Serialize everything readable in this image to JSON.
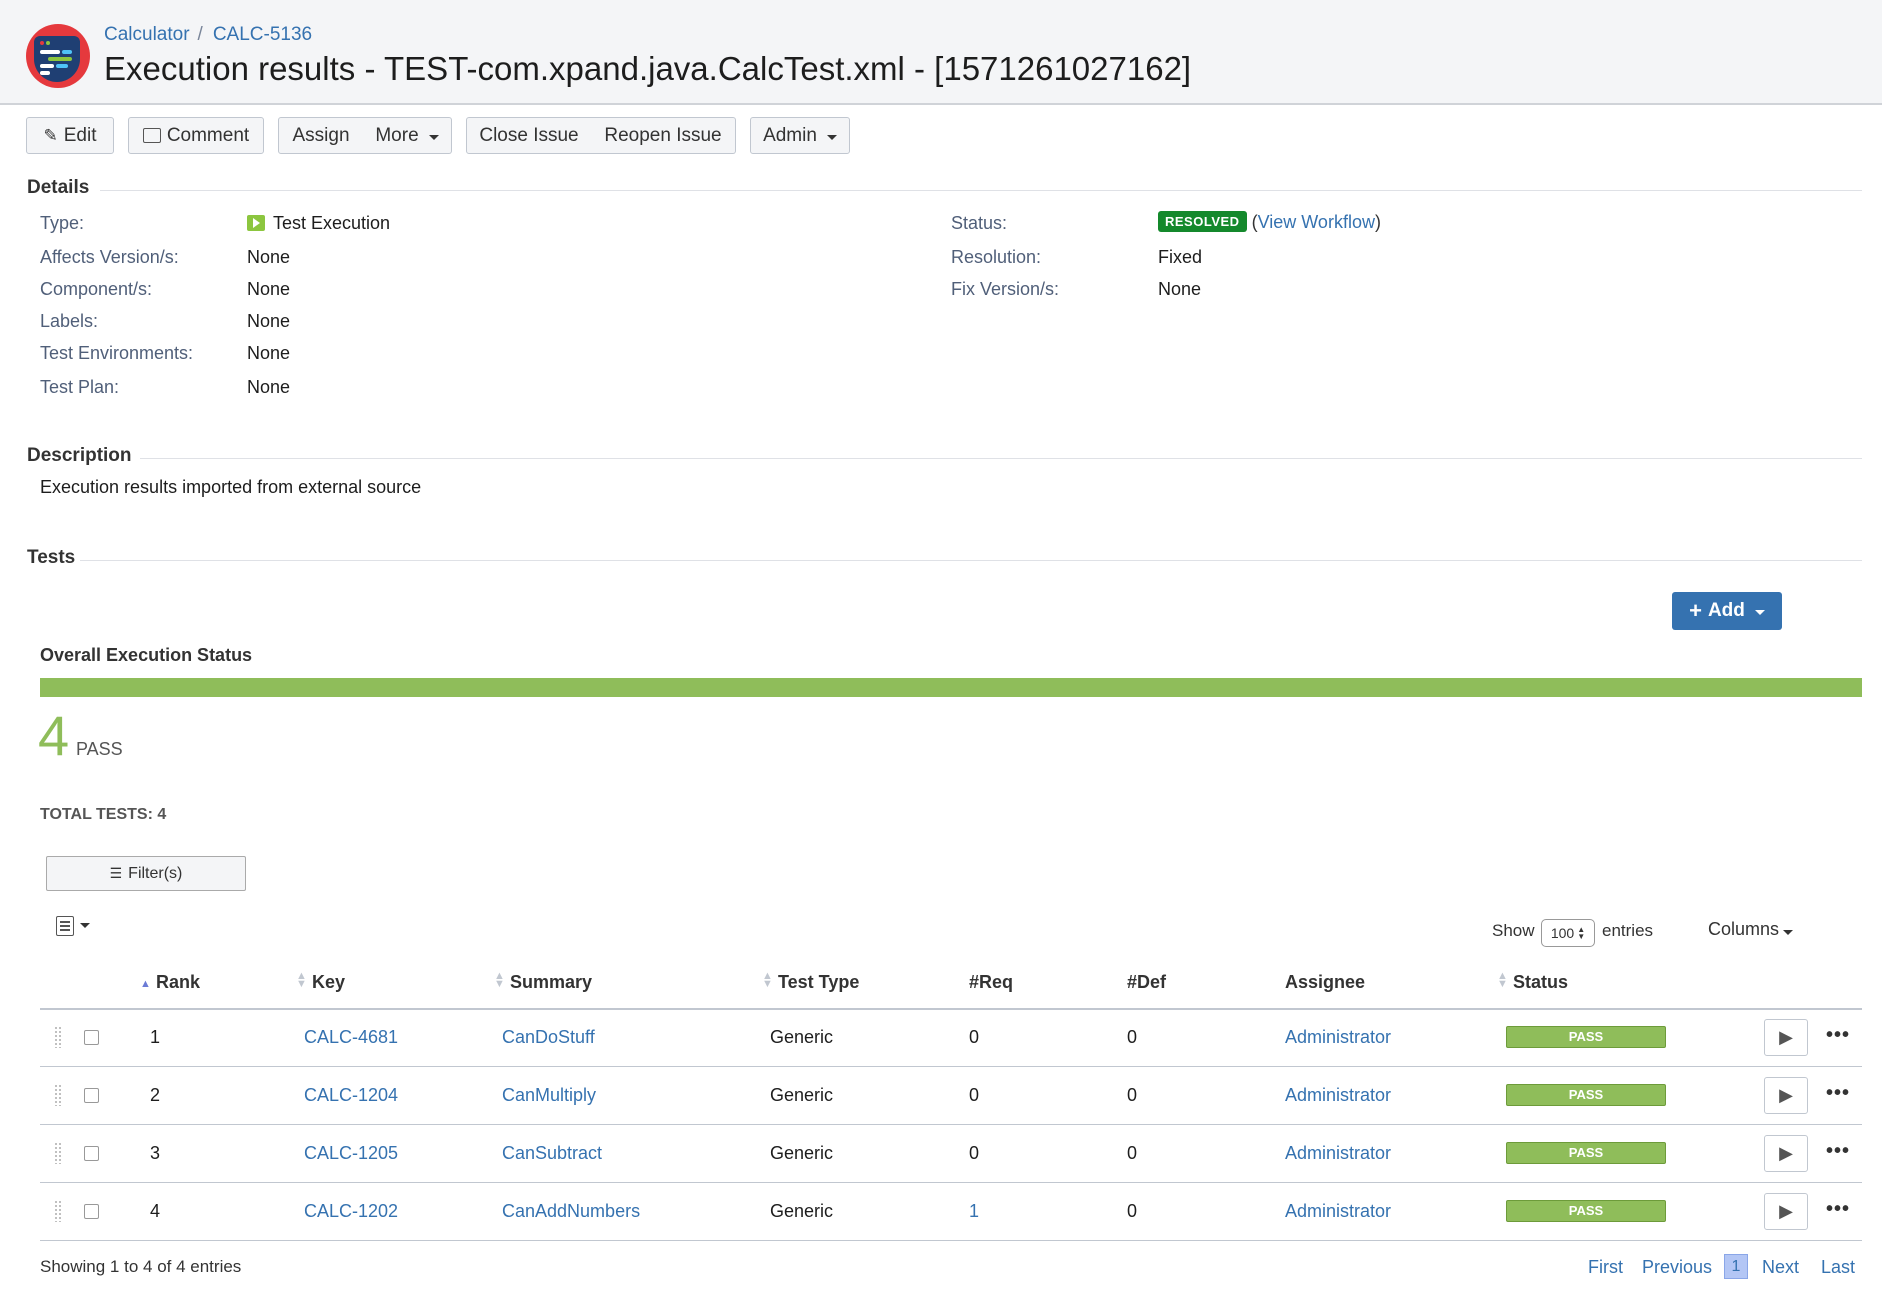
{
  "header": {
    "breadcrumb": [
      "Calculator",
      "CALC-5136"
    ],
    "breadcrumb_sep": "/",
    "title": "Execution results - TEST-com.xpand.java.CalcTest.xml - [1571261027162]"
  },
  "toolbar": {
    "edit": "Edit",
    "comment": "Comment",
    "assign": "Assign",
    "more": "More",
    "close_issue": "Close Issue",
    "reopen_issue": "Reopen Issue",
    "admin": "Admin"
  },
  "details": {
    "title": "Details",
    "left": [
      {
        "label": "Type:",
        "value": "Test Execution"
      },
      {
        "label": "Affects Version/s:",
        "value": "None"
      },
      {
        "label": "Component/s:",
        "value": "None"
      },
      {
        "label": "Labels:",
        "value": "None"
      },
      {
        "label": "Test Environments:",
        "value": "None"
      },
      {
        "label": "Test Plan:",
        "value": "None"
      }
    ],
    "right": [
      {
        "label": "Status:",
        "badge": "RESOLVED",
        "link": "View Workflow"
      },
      {
        "label": "Resolution:",
        "value": "Fixed"
      },
      {
        "label": "Fix Version/s:",
        "value": "None"
      }
    ]
  },
  "description": {
    "title": "Description",
    "text": "Execution results imported from external source"
  },
  "tests": {
    "title": "Tests",
    "add_label": "Add",
    "overall_title": "Overall Execution Status",
    "pass_count": "4",
    "pass_label": "PASS",
    "pass_fraction": 1.0,
    "total_tests": "TOTAL TESTS: 4",
    "filter_label": "Filter(s)",
    "show_label": "Show",
    "page_size": "100",
    "entries_label": "entries",
    "columns_label": "Columns",
    "headers": {
      "rank": "Rank",
      "key": "Key",
      "summary": "Summary",
      "test_type": "Test Type",
      "req": "#Req",
      "def": "#Def",
      "assignee": "Assignee",
      "status": "Status"
    },
    "rows": [
      {
        "rank": "1",
        "key": "CALC-4681",
        "summary": "CanDoStuff",
        "type": "Generic",
        "req": "0",
        "def": "0",
        "assignee": "Administrator",
        "status": "PASS"
      },
      {
        "rank": "2",
        "key": "CALC-1204",
        "summary": "CanMultiply",
        "type": "Generic",
        "req": "0",
        "def": "0",
        "assignee": "Administrator",
        "status": "PASS"
      },
      {
        "rank": "3",
        "key": "CALC-1205",
        "summary": "CanSubtract",
        "type": "Generic",
        "req": "0",
        "def": "0",
        "assignee": "Administrator",
        "status": "PASS"
      },
      {
        "rank": "4",
        "key": "CALC-1202",
        "summary": "CanAddNumbers",
        "type": "Generic",
        "req": "1",
        "def": "0",
        "assignee": "Administrator",
        "status": "PASS"
      }
    ],
    "showing": "Showing 1 to 4 of 4 entries",
    "pagination": {
      "first": "First",
      "previous": "Previous",
      "current": "1",
      "next": "Next",
      "last": "Last"
    }
  },
  "colors": {
    "link": "#3572b0",
    "pass": "#8fbd5a",
    "resolved": "#14892c",
    "logo_red": "#e5393d",
    "logo_navy": "#1f3f73"
  }
}
